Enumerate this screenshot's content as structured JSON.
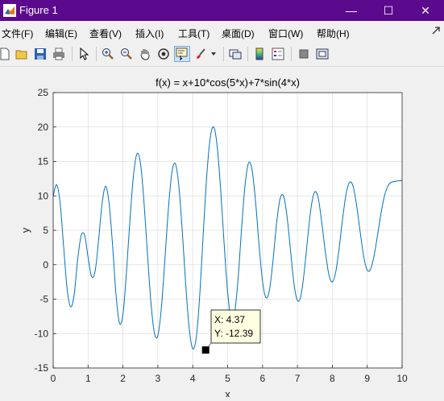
{
  "window": {
    "title": "Figure 1",
    "buttons": {
      "minimize": "—",
      "maximize": "☐",
      "close": "✕"
    }
  },
  "menu": [
    {
      "label": "文件(F)"
    },
    {
      "label": "编辑(E)"
    },
    {
      "label": "查看(V)"
    },
    {
      "label": "插入(I)"
    },
    {
      "label": "工具(T)"
    },
    {
      "label": "桌面(D)"
    },
    {
      "label": "窗口(W)"
    },
    {
      "label": "帮助(H)"
    }
  ],
  "toolbar": [
    {
      "icon": "new-figure-icon"
    },
    {
      "icon": "open-file-icon"
    },
    {
      "icon": "save-icon"
    },
    {
      "icon": "print-icon"
    },
    {
      "icon": "edit-plot-arrow-icon"
    },
    {
      "icon": "zoom-in-icon"
    },
    {
      "icon": "zoom-out-icon"
    },
    {
      "icon": "pan-hand-icon"
    },
    {
      "icon": "rotate-3d-icon"
    },
    {
      "icon": "data-cursor-icon",
      "active": true
    },
    {
      "icon": "brush-icon"
    },
    {
      "icon": "link-plot-icon"
    },
    {
      "icon": "colorbar-icon"
    },
    {
      "icon": "legend-icon"
    },
    {
      "icon": "hide-plot-tools-icon"
    },
    {
      "icon": "show-plot-tools-icon"
    }
  ],
  "colors": {
    "titlebar": "#5b0a8e",
    "line": "#0072bd",
    "grid": "#dfdfdf",
    "datatip_bg": "#ffffe1"
  },
  "chart_data": {
    "type": "line",
    "title": "f(x) = x+10*cos(5*x)+7*sin(4*x)",
    "xlabel": "x",
    "ylabel": "y",
    "xlim": [
      0,
      10
    ],
    "ylim": [
      -15,
      25
    ],
    "xticks": [
      0,
      1,
      2,
      3,
      4,
      5,
      6,
      7,
      8,
      9,
      10
    ],
    "yticks": [
      -15,
      -10,
      -5,
      0,
      5,
      10,
      15,
      20,
      25
    ],
    "grid": true,
    "series": [
      {
        "x": [
          0,
          0.1,
          0.2,
          0.3,
          0.4,
          0.5,
          0.6,
          0.7,
          0.8,
          0.9,
          1.0,
          1.1,
          1.2,
          1.3,
          1.4,
          1.5,
          1.6,
          1.7,
          1.8,
          1.9,
          2.0,
          2.1,
          2.2,
          2.3,
          2.4,
          2.5,
          2.6,
          2.7,
          2.8,
          2.9,
          3.0,
          3.1,
          3.2,
          3.3,
          3.4,
          3.5,
          3.6,
          3.7,
          3.8,
          3.9,
          4.0,
          4.1,
          4.2,
          4.3,
          4.4,
          4.5,
          4.6,
          4.7,
          4.8,
          4.9,
          5.0,
          5.1,
          5.2,
          5.3,
          5.4,
          5.5,
          5.6,
          5.7,
          5.8,
          5.9,
          6.0,
          6.1,
          6.2,
          6.3,
          6.4,
          6.5,
          6.6,
          6.7,
          6.8,
          6.9,
          7.0,
          7.1,
          7.2,
          7.3,
          7.4,
          7.5,
          7.6,
          7.7,
          7.8,
          7.9,
          8.0,
          8.1,
          8.2,
          8.3,
          8.4,
          8.5,
          8.6,
          8.7,
          8.8,
          8.9,
          9.0,
          9.1,
          9.2,
          9.3,
          9.4,
          9.5,
          9.6,
          9.7,
          9.8,
          9.9,
          10.0
        ],
        "y": [
          10.0,
          11.6,
          8.9,
          2.6,
          -3.5,
          -6.1,
          -4.4,
          0.7,
          4.2,
          4.3,
          1.1,
          -1.7,
          -1.0,
          3.5,
          8.8,
          11.4,
          9.0,
          3.0,
          -4.3,
          -8.5,
          -7.2,
          -1.1,
          6.5,
          12.9,
          16.1,
          14.8,
          9.3,
          1.7,
          -5.4,
          -9.9,
          -10.3,
          -6.3,
          0.6,
          8.0,
          13.3,
          14.7,
          11.5,
          4.9,
          -3.0,
          -9.3,
          -12.2,
          -10.6,
          -4.5,
          4.4,
          12.8,
          18.4,
          20.0,
          17.2,
          10.9,
          3.0,
          -4.0,
          -7.8,
          -7.0,
          -2.0,
          5.3,
          11.6,
          14.8,
          13.8,
          9.2,
          2.9,
          -2.4,
          -4.8,
          -3.6,
          0.6,
          5.9,
          9.5,
          10.0,
          7.1,
          2.2,
          -2.7,
          -5.2,
          -4.5,
          -0.8,
          4.2,
          8.6,
          10.6,
          9.6,
          6.0,
          1.9,
          -1.4,
          -2.5,
          -1.0,
          2.6,
          6.9,
          10.4,
          12.0,
          11.3,
          8.5,
          4.7,
          1.2,
          -0.8,
          -0.6,
          1.4,
          4.4,
          7.6,
          10.1,
          11.5,
          12.0,
          12.1,
          12.2,
          12.2
        ]
      }
    ],
    "datatip": {
      "x": 4.37,
      "y": -12.39,
      "label_x": "X: 4.37",
      "label_y": "Y: -12.39"
    }
  }
}
